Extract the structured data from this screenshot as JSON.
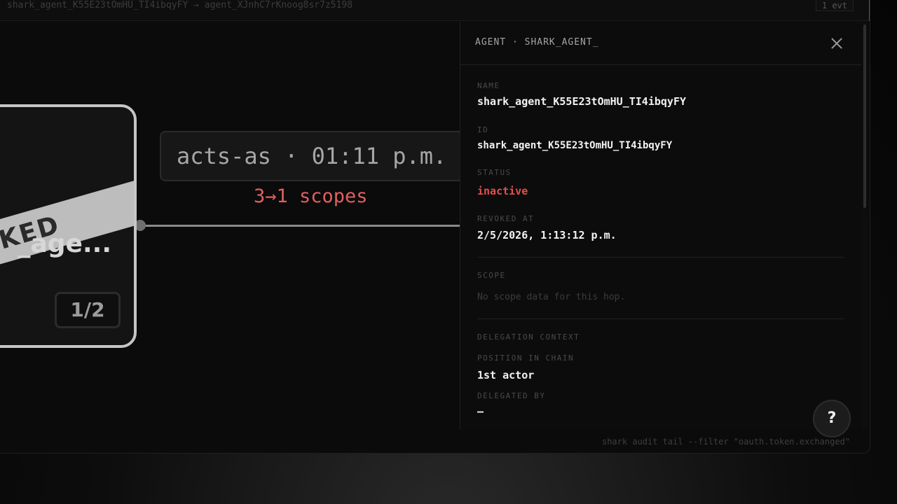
{
  "topbar": {
    "path": "shark_agent_K55E23tOmHU_TI4ibqyFY → agent_XJnhC7rKnoog8sr7z5198",
    "event_count": "1 evt"
  },
  "canvas": {
    "node": {
      "badge": "REVOKED",
      "ribbon_visible": "OKED",
      "name_visible": "_age...",
      "counter": "1/2"
    },
    "edge": {
      "label": "acts-as · 01:11 p.m.",
      "scopes": "3→1 scopes"
    }
  },
  "panel": {
    "title": "AGENT · SHARK_AGENT_",
    "name_label": "NAME",
    "name_value": "shark_agent_K55E23tOmHU_TI4ibqyFY",
    "id_label": "ID",
    "id_value": "shark_agent_K55E23tOmHU_TI4ibqyFY",
    "status_label": "STATUS",
    "status_value": "inactive",
    "revoked_label": "REVOKED AT",
    "revoked_value": "2/5/2026, 1:13:12 p.m.",
    "scope_label": "SCOPE",
    "scope_value": "No scope data for this hop.",
    "delegation_label": "DELEGATION CONTEXT",
    "position_label": "POSITION IN CHAIN",
    "position_value": "1st actor",
    "delegated_by_label": "DELEGATED BY",
    "delegated_by_value": "—"
  },
  "help": {
    "label": "?"
  },
  "command": "shark audit tail --filter \"oauth.token.exchanged\"",
  "colors": {
    "danger": "#e0504e",
    "accent": "#2f6f2f"
  }
}
